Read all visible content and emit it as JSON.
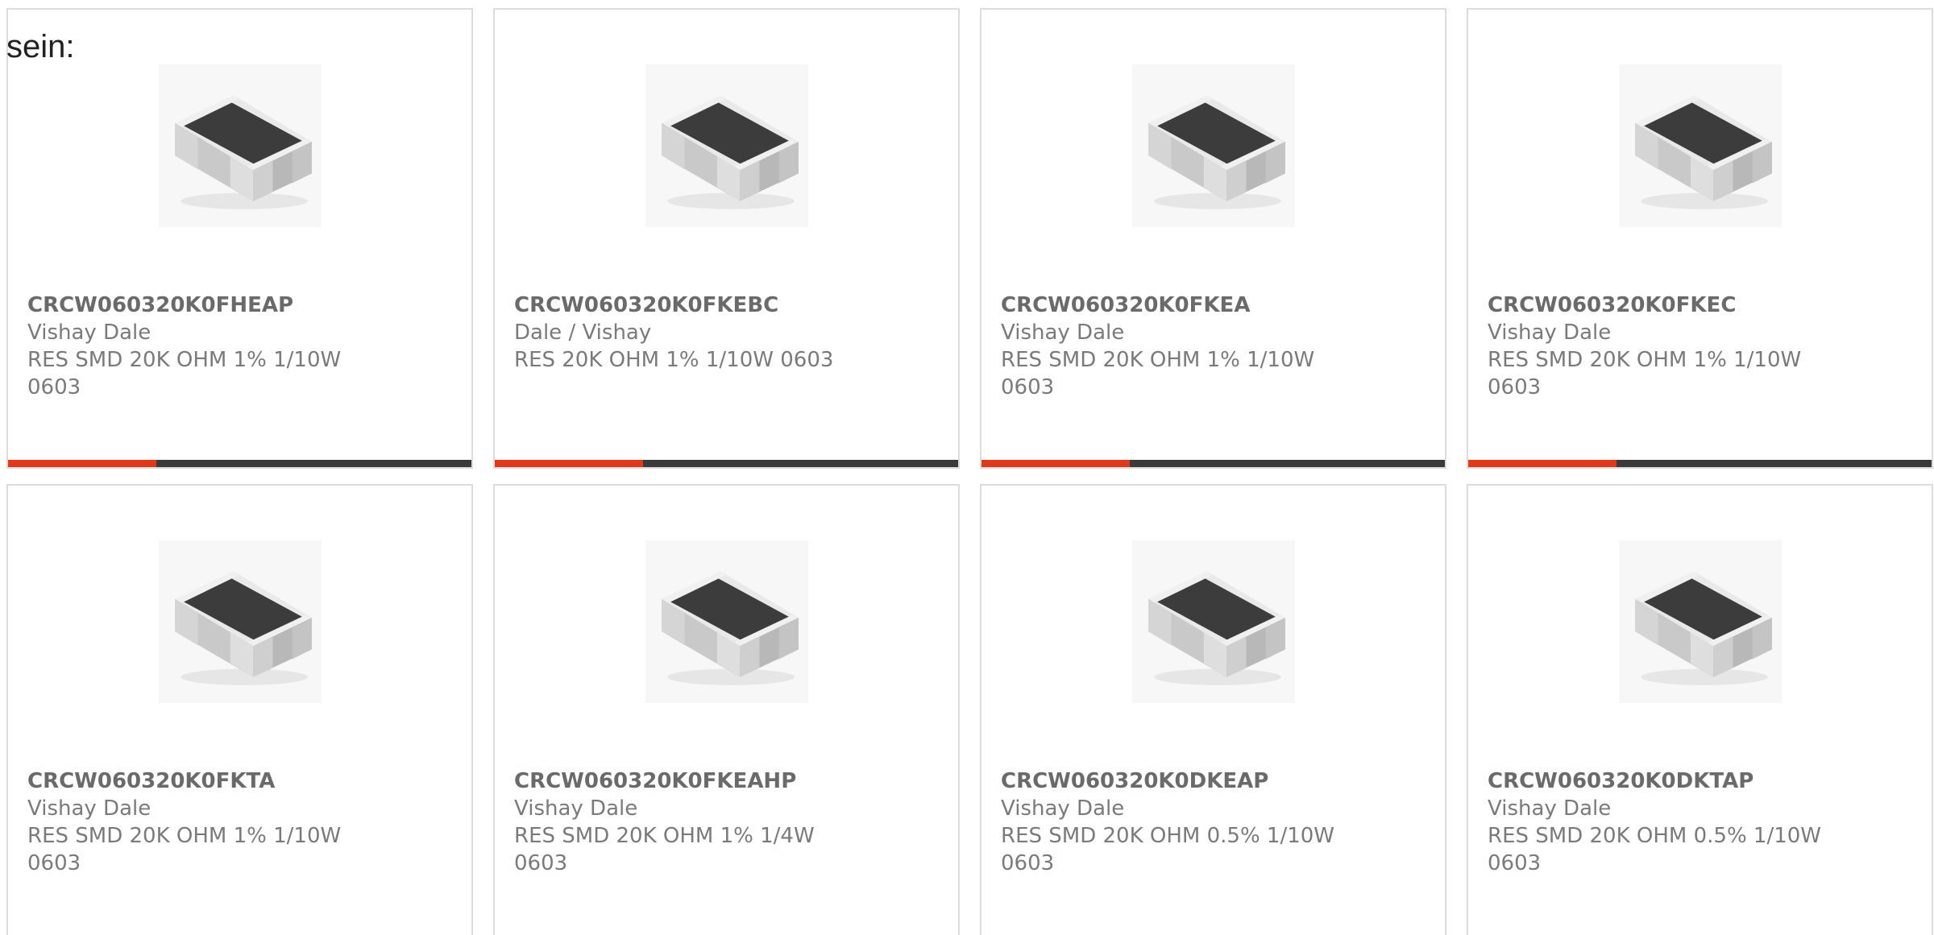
{
  "page": {
    "intro_text": "sein:"
  },
  "colors": {
    "accent_red": "#e0381b",
    "accent_dark": "#3a3a3a",
    "card_border": "#dcdcdc",
    "text_gray": "#7a7a7a"
  },
  "products": [
    {
      "part_number": "CRCW060320K0FHEAP",
      "manufacturer": "Vishay Dale",
      "description_line1": "RES SMD 20K OHM 1% 1/10W",
      "description_line2": "0603",
      "image_icon": "smd-resistor-chip-icon",
      "accent_fraction": 0.32
    },
    {
      "part_number": "CRCW060320K0FKEBC",
      "manufacturer": "Dale / Vishay",
      "description_line1": "RES 20K OHM 1% 1/10W 0603",
      "description_line2": "",
      "image_icon": "smd-resistor-chip-icon",
      "accent_fraction": 0.32
    },
    {
      "part_number": "CRCW060320K0FKEA",
      "manufacturer": "Vishay Dale",
      "description_line1": "RES SMD 20K OHM 1% 1/10W",
      "description_line2": "0603",
      "image_icon": "smd-resistor-chip-icon",
      "accent_fraction": 0.32
    },
    {
      "part_number": "CRCW060320K0FKEC",
      "manufacturer": "Vishay Dale",
      "description_line1": "RES SMD 20K OHM 1% 1/10W",
      "description_line2": "0603",
      "image_icon": "smd-resistor-chip-icon",
      "accent_fraction": 0.32
    },
    {
      "part_number": "CRCW060320K0FKTA",
      "manufacturer": "Vishay Dale",
      "description_line1": "RES SMD 20K OHM 1% 1/10W",
      "description_line2": "0603",
      "image_icon": "smd-resistor-chip-icon",
      "accent_fraction": 0.32
    },
    {
      "part_number": "CRCW060320K0FKEAHP",
      "manufacturer": "Vishay Dale",
      "description_line1": "RES SMD 20K OHM 1% 1/4W",
      "description_line2": "0603",
      "image_icon": "smd-resistor-chip-icon",
      "accent_fraction": 0.32
    },
    {
      "part_number": "CRCW060320K0DKEAP",
      "manufacturer": "Vishay Dale",
      "description_line1": "RES SMD 20K OHM 0.5% 1/10W",
      "description_line2": "0603",
      "image_icon": "smd-resistor-chip-icon",
      "accent_fraction": 0.32
    },
    {
      "part_number": "CRCW060320K0DKTAP",
      "manufacturer": "Vishay Dale",
      "description_line1": "RES SMD 20K OHM 0.5% 1/10W",
      "description_line2": "0603",
      "image_icon": "smd-resistor-chip-icon",
      "accent_fraction": 0.32
    }
  ]
}
